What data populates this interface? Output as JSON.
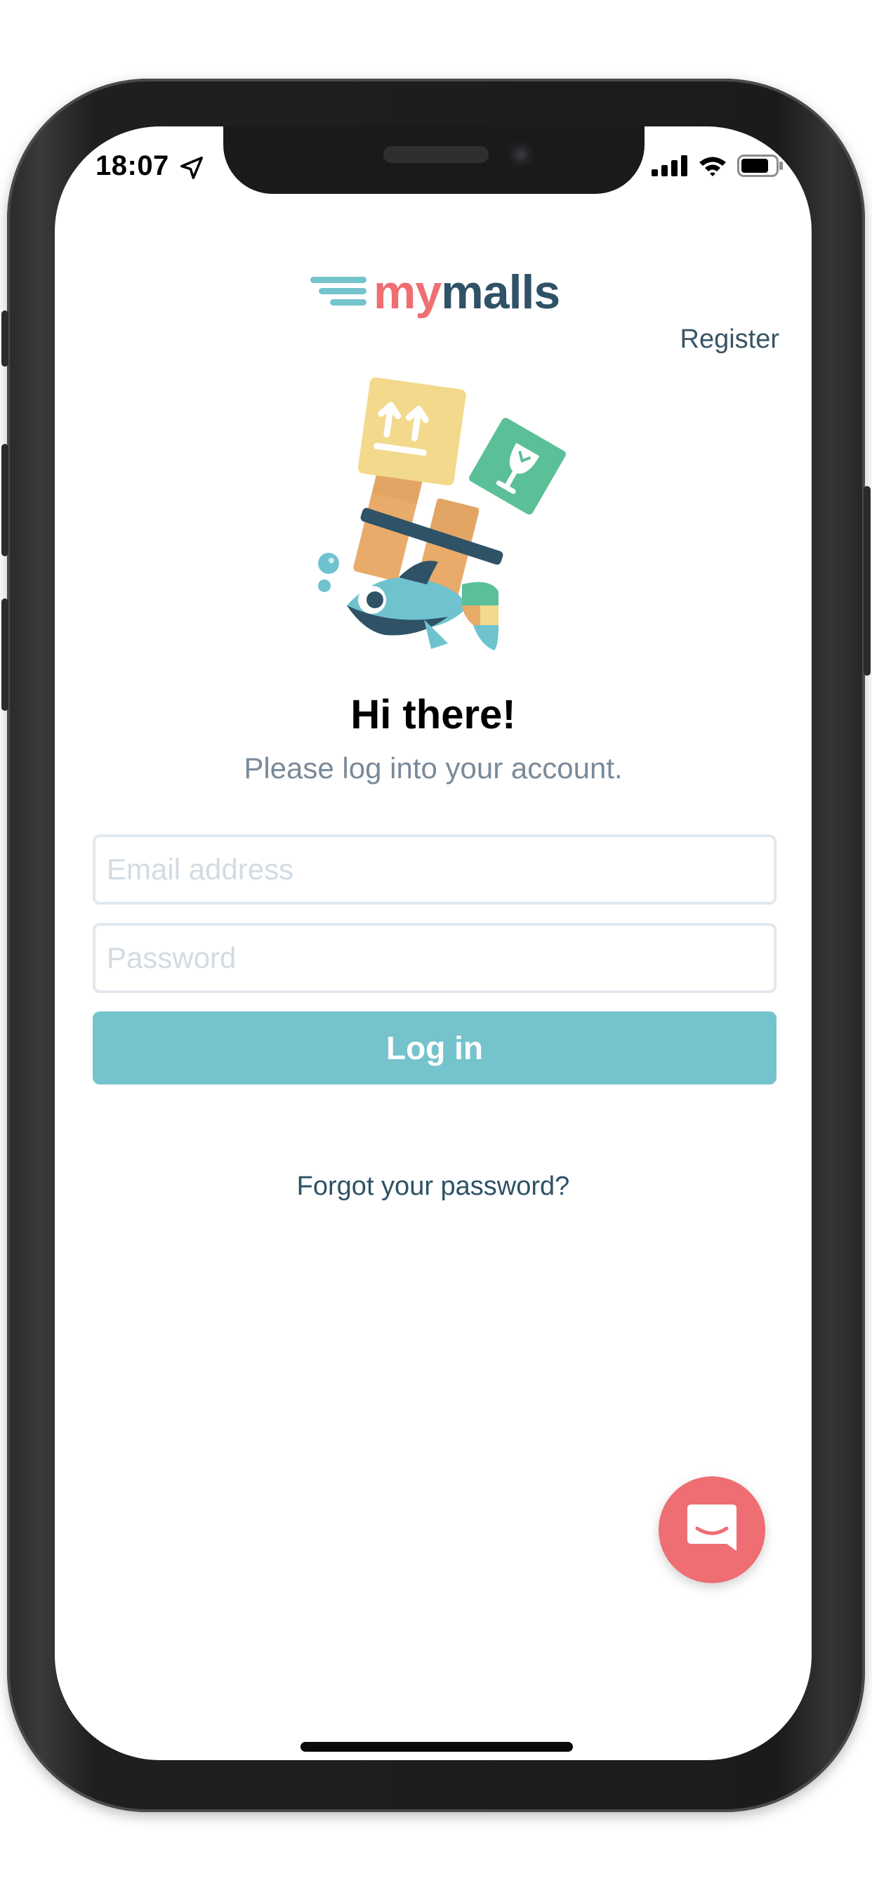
{
  "status_bar": {
    "time": "18:07",
    "icons": [
      "location-arrow-icon",
      "cellular-signal-icon",
      "wifi-icon",
      "battery-icon"
    ]
  },
  "app": {
    "logo_part1": "my",
    "logo_part2": "malls",
    "register_label": "Register"
  },
  "login": {
    "title": "Hi there!",
    "subtitle": "Please log into your account.",
    "email_placeholder": "Email address",
    "password_placeholder": "Password",
    "login_label": "Log in",
    "forgot_label": "Forgot your password?"
  },
  "chat": {
    "icon": "chat-bubble-icon"
  },
  "colors": {
    "brand_teal": "#75c3cc",
    "brand_pink": "#ee6e73",
    "brand_navy": "#2f5266",
    "input_border": "#e1e8ee",
    "subtitle_gray": "#7a8a99"
  }
}
